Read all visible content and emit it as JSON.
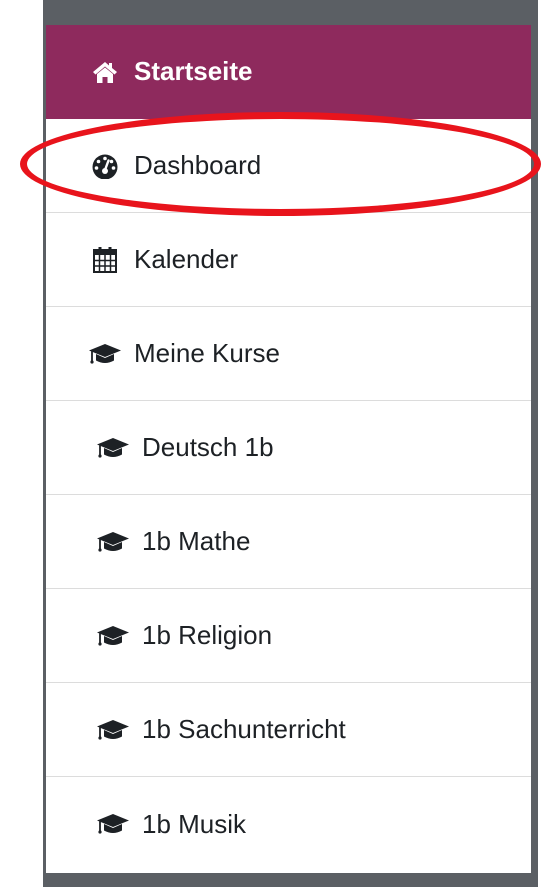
{
  "nav": {
    "items": [
      {
        "label": "Startseite",
        "icon": "home-icon",
        "active": true,
        "level": 0
      },
      {
        "label": "Dashboard",
        "icon": "dashboard-icon",
        "active": false,
        "level": 0
      },
      {
        "label": "Kalender",
        "icon": "calendar-icon",
        "active": false,
        "level": 0
      },
      {
        "label": "Meine Kurse",
        "icon": "graduation-cap-icon",
        "active": false,
        "level": 0
      },
      {
        "label": "Deutsch 1b",
        "icon": "graduation-cap-icon",
        "active": false,
        "level": 1
      },
      {
        "label": "1b Mathe",
        "icon": "graduation-cap-icon",
        "active": false,
        "level": 1
      },
      {
        "label": "1b Religion",
        "icon": "graduation-cap-icon",
        "active": false,
        "level": 1
      },
      {
        "label": "1b Sachunterricht",
        "icon": "graduation-cap-icon",
        "active": false,
        "level": 1
      },
      {
        "label": "1b Musik",
        "icon": "graduation-cap-icon",
        "active": false,
        "level": 1
      }
    ]
  },
  "colors": {
    "active_bg": "#8e2a5d",
    "frame": "#5b5f64",
    "highlight": "#e8141c"
  }
}
